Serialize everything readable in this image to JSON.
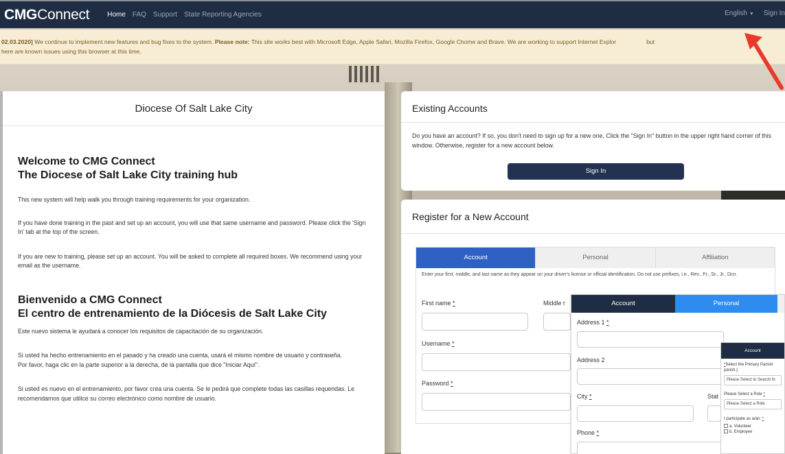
{
  "nav": {
    "brand_bold": "CMG",
    "brand_light": "Connect",
    "links": [
      "Home",
      "FAQ",
      "Support",
      "State Reporting Agencies"
    ],
    "language": "English",
    "signin": "Sign In"
  },
  "alert": {
    "date": "02.03.2020]",
    "text1": " We continue to implement new features and bug fixes to the system. ",
    "note_label": "Please note:",
    "text2": " This site works best with Microsoft Edge, Apple Safari, Mozilla Firefox, Google Chome and Brave. We are working to support Internet Explor",
    "text3": "but",
    "line2": "here are known issues using this browser at this time."
  },
  "left": {
    "title": "Diocese Of Salt Lake City",
    "welcome_1": "Welcome to CMG Connect",
    "welcome_2": "The Diocese of Salt Lake City training hub",
    "p1": "This new system will help walk you through training requirements for your organization.",
    "p2": "If you have done training in the past and set up an account, you will use that same username and password. Please click the 'Sign In' tab at the top of the screen.",
    "p3": "If you are new to training, please set up an account.  You will be asked to complete all required boxes.  We recommend using your email as the username.",
    "bien_1": "Bienvenido a CMG Connect",
    "bien_2": "El centro de entrenamiento de la Diócesis de Salt Lake City",
    "p4": "Este nuevo sistema le ayudará a conocer los requisitos de capacitación de su organización.",
    "p5a": "Si usted ha hecho entrenamiento en el pasado y ha creado una cuenta, usará el mismo nombre de usuario y contraseña.",
    "p5b": "Por favor, haga clic en la parte superior a la derecha, de la pantalla que dice \"Iniciar Aquí\".",
    "p6": "Si usted es nuevo en el entrenamiento, por favor crea una cuenta. Se le pedirá que complete todas las casillas requeridas. Le recomendamos que utilice su correo electrónico como nombre de usuario."
  },
  "existing": {
    "title": "Existing Accounts",
    "text": "Do you have an account? If so, you don't need to sign up for a new one. Click the \"Sign In\" button in the upper right hand corner of this window. Otherwise, register for a new account below.",
    "button": "Sign In"
  },
  "register": {
    "title": "Register for a New Account",
    "tabs": [
      "Account",
      "Personal",
      "Affiliation"
    ],
    "note": "Enter your first, middle, and last name as they appear on your driver's license or official identification. Do not use prefixes, i.e., Rev., Fr., Sr., Jr., Dcn.",
    "first_name": "First name",
    "middle": "Middle r",
    "username": "Username",
    "password": "Password",
    "req": "*"
  },
  "overlay_personal": {
    "tab_account": "Account",
    "tab_personal": "Personal",
    "address1": "Address 1",
    "address2": "Address 2",
    "city": "City",
    "state": "Stat",
    "phone": "Phone",
    "req": "*"
  },
  "overlay_affiliation": {
    "tab": "Account",
    "parish_label_req": "*",
    "parish_label": "Select the Primary Parish/",
    "parish_label_2": "parish.)",
    "parish_select": "Please Select to Search fo",
    "role_label": "Please Select a Role",
    "role_select": "Please Select a Role",
    "participate_label": "I participate as a/an:",
    "opt_a": "a. Volunteer",
    "opt_b": "b. Employee",
    "req": "*"
  },
  "colors": {
    "navbar": "#1f2d44",
    "tab_active": "#2f61c5",
    "alert_bg": "#f6edd4",
    "arrow": "#e8392a"
  }
}
